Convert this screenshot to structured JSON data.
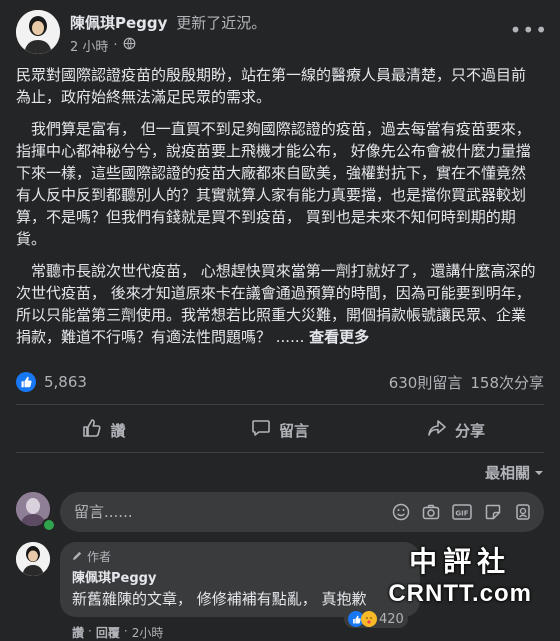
{
  "post": {
    "author": "陳佩琪Peggy",
    "action": "更新了近況。",
    "time": "2 小時",
    "paragraphs": [
      "民眾對國際認證疫苗的殷殷期盼，站在第一線的醫療人員最清楚，只不過目前為止，政府始終無法滿足民眾的需求。",
      "　我們算是富有，  但一直買不到足夠國際認證的疫苗，過去每當有疫苗要來，指揮中心都神秘兮兮，說疫苗要上飛機才能公布，  好像先公布會被什麼力量擋下來一樣，這些國際認證的疫苗大廠都來自歐美，強權對抗下，實在不懂竟然有人反中反到都聽別人的？其實就算人家有能力真要擋，也是擋你買武器較划算，不是嗎？但我們有錢就是買不到疫苗，  買到也是未來不知何時到期的期貨。",
      "　常聽市長說次世代疫苗，  心想趕快買來當第一劑打就好了，  還講什麼高深的次世代疫苗，  後來才知道原來卡在議會通過預算的時間，因為可能要到明年，所以只能當第三劑使用。我常想若比照重大災難，開個捐款帳號讓民眾、企業捐款，難道不行嗎？有適法性問題嗎？ ...... "
    ],
    "see_more": "查看更多"
  },
  "stats": {
    "likes": "5,863",
    "comments": "630則留言",
    "shares": "158次分享"
  },
  "actions": {
    "like": "讚",
    "comment": "留言",
    "share": "分享"
  },
  "sort": {
    "label": "最相關"
  },
  "comment_input": {
    "placeholder": "留言......"
  },
  "comment": {
    "tag": "作者",
    "name": "陳佩琪Peggy",
    "text": "新舊雜陳的文章，  修修補補有點亂，  真抱歉",
    "reaction_count": "420",
    "like": "讚",
    "reply": "回覆",
    "sep": "·",
    "time": "2小時"
  },
  "watermark": {
    "cn": "中評社",
    "en": "CRNTT.com"
  },
  "colors": {
    "background": "#242526",
    "bubble": "#3a3b3c",
    "like_blue": "#1877f2"
  }
}
